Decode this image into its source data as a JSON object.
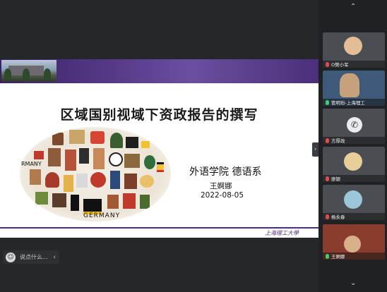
{
  "slide": {
    "title": "区域国别视域下资政报告的撰写",
    "department": "外语学院 德语系",
    "author": "王婀娜",
    "date": "2022-08-05",
    "collage_label": "GERMANY",
    "collage_label_left": "RMANY",
    "university_logo_text": "上海理工大學"
  },
  "chat": {
    "placeholder": "说点什么...",
    "emoji_icon": "smile-icon",
    "expand_icon": "chevron-left-icon"
  },
  "sidebar": {
    "participants": [
      {
        "name": "O樊小军",
        "mic": "off"
      },
      {
        "name": "管明玢-上海理工",
        "mic": "on"
      },
      {
        "name": "方厚政",
        "mic": "off"
      },
      {
        "name": "廖颖",
        "mic": "off"
      },
      {
        "name": "杨永春",
        "mic": "off"
      },
      {
        "name": "王婀娜",
        "mic": "on"
      }
    ]
  },
  "colors": {
    "banner": "#4b2f79",
    "background": "#25272a",
    "mic_off": "#e34b4b",
    "mic_on": "#3ccf6b"
  }
}
